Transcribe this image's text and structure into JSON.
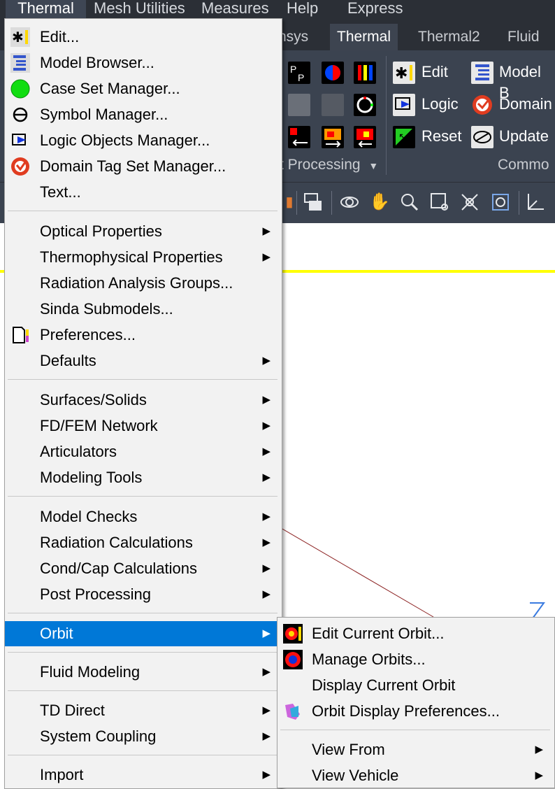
{
  "menubar": {
    "items": [
      "Thermal",
      "Mesh Utilities",
      "Measures",
      "Help",
      "Express"
    ]
  },
  "ribbon": {
    "tabs": [
      "nsys",
      "Thermal",
      "Thermal2",
      "Fluid"
    ],
    "buttons": {
      "edit": "Edit",
      "model_browser": "Model B",
      "logic": "Logic",
      "domain": "Domain",
      "reset": "Reset",
      "update": "Update"
    },
    "groups": {
      "post_processing": "t Processing",
      "common": "Commo"
    }
  },
  "thermal_menu": {
    "items": [
      {
        "label": "Edit...",
        "icon": "edit-asterisk-icon"
      },
      {
        "label": "Model Browser...",
        "icon": "model-browser-icon"
      },
      {
        "label": "Case Set Manager...",
        "icon": "green-circle-icon"
      },
      {
        "label": "Symbol Manager...",
        "icon": "symbol-theta-icon"
      },
      {
        "label": "Logic Objects Manager...",
        "icon": "logic-objects-icon"
      },
      {
        "label": "Domain Tag Set Manager...",
        "icon": "domain-tag-icon"
      },
      {
        "label": "Text...",
        "icon": ""
      },
      {
        "label": "Optical Properties",
        "submenu": true
      },
      {
        "label": "Thermophysical Properties",
        "submenu": true
      },
      {
        "label": "Radiation Analysis Groups..."
      },
      {
        "label": "Sinda Submodels..."
      },
      {
        "label": "Preferences...",
        "icon": "preferences-icon"
      },
      {
        "label": "Defaults",
        "submenu": true
      },
      {
        "label": "Surfaces/Solids",
        "submenu": true
      },
      {
        "label": "FD/FEM Network",
        "submenu": true
      },
      {
        "label": "Articulators",
        "submenu": true
      },
      {
        "label": "Modeling Tools",
        "submenu": true
      },
      {
        "label": "Model Checks",
        "submenu": true
      },
      {
        "label": "Radiation Calculations",
        "submenu": true
      },
      {
        "label": "Cond/Cap Calculations",
        "submenu": true
      },
      {
        "label": "Post Processing",
        "submenu": true
      },
      {
        "label": "Orbit",
        "submenu": true,
        "highlighted": true
      },
      {
        "label": "Fluid Modeling",
        "submenu": true
      },
      {
        "label": "TD Direct",
        "submenu": true
      },
      {
        "label": "System Coupling",
        "submenu": true
      },
      {
        "label": "Import",
        "submenu": true
      }
    ]
  },
  "orbit_menu": {
    "items": [
      {
        "label": "Edit Current Orbit...",
        "icon": "edit-orbit-icon"
      },
      {
        "label": "Manage Orbits...",
        "icon": "manage-orbits-icon"
      },
      {
        "label": "Display Current Orbit"
      },
      {
        "label": "Orbit Display Preferences...",
        "icon": "orbit-preferences-icon"
      },
      {
        "label": "View From",
        "submenu": true
      },
      {
        "label": "View Vehicle",
        "submenu": true
      }
    ]
  },
  "viewport": {
    "axis_label": "Z"
  },
  "colors": {
    "menubar_bg": "#2b2f36",
    "ribbon_bg": "#3b4350",
    "menu_bg": "#f2f2f2",
    "highlight": "#0078d7",
    "yellow_line": "#ffff00"
  }
}
